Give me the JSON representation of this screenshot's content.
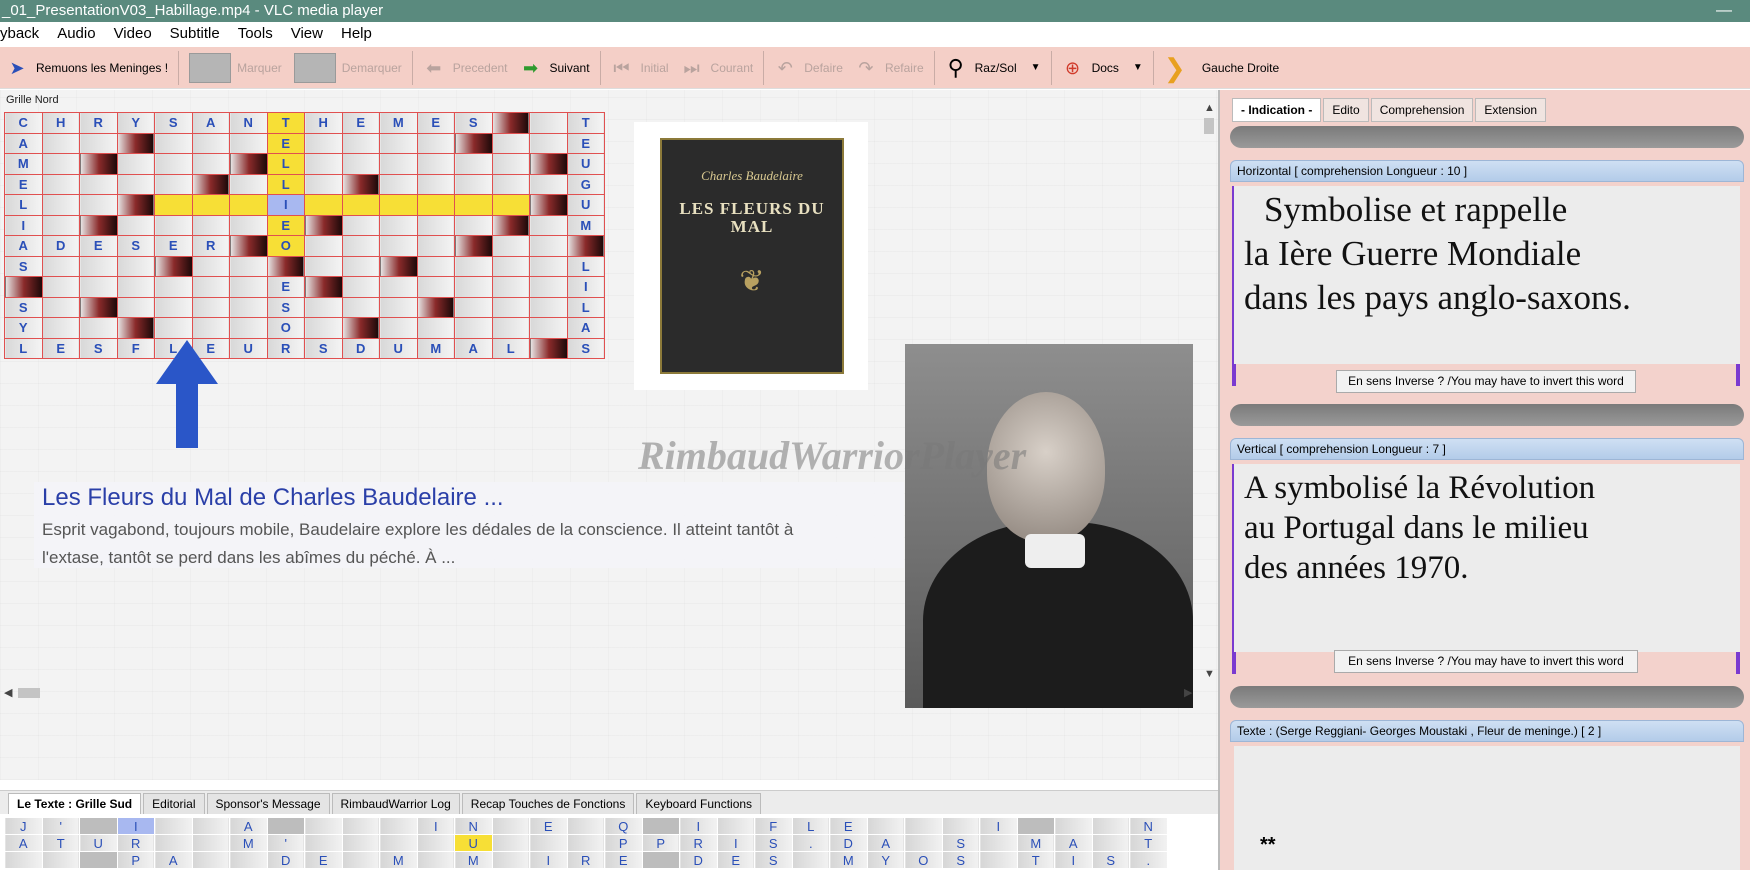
{
  "window": {
    "title": "_01_PresentationV03_Habillage.mp4 - VLC media player",
    "minimize": "—"
  },
  "menu": [
    "yback",
    "Audio",
    "Video",
    "Subtitle",
    "Tools",
    "View",
    "Help"
  ],
  "toolbar": {
    "remuons": "Remuons les Meninges !",
    "marquer": "Marquer",
    "demarquer": "Demarquer",
    "precedent": "Precedent",
    "suivant": "Suivant",
    "initial": "Initial",
    "courant": "Courant",
    "defaire": "Defaire",
    "refaire": "Refaire",
    "razsol": "Raz/Sol",
    "docs": "Docs",
    "gauche_droite": "Gauche Droite"
  },
  "left": {
    "grid_label": "Grille Nord",
    "watermark": "RimbaudWarriorPlayer",
    "snippet_title": "Les Fleurs du Mal de Charles Baudelaire ...",
    "snippet_line1": "Esprit vagabond, toujours mobile, Baudelaire explore les dédales de la conscience. Il atteint tantôt à",
    "snippet_line2": "l'extase, tantôt se perd dans les abîmes du péché. À ...",
    "book_author": "Charles Baudelaire",
    "book_title": "LES FLEURS DU MAL"
  },
  "bottom_tabs": [
    "Le Texte : Grille Sud",
    "Editorial",
    "Sponsor's Message",
    "RimbaudWarrior Log",
    "Recap Touches de Fonctions",
    "Keyboard Functions"
  ],
  "right": {
    "tabs": [
      "- Indication -",
      "Edito",
      "Comprehension",
      "Extension"
    ],
    "h_header": "Horizontal [ comprehension  Longueur : 10 ]",
    "h_line1": "Symbolise et rappelle",
    "h_line2": "la Ière Guerre Mondiale",
    "h_line3": "dans les pays anglo-saxons.",
    "invert": "En sens Inverse ? /You may have to invert this word",
    "v_header": "Vertical [ comprehension  Longueur : 7 ]",
    "v_line1": "A symbolisé la Révolution",
    "v_line2": "au Portugal dans le milieu",
    "v_line3": "des années 1970.",
    "texte_header": "Texte :  (Serge Reggiani- Georges Moustaki , Fleur de meninge.)  [ 2 ]",
    "stars": "**"
  },
  "grid_north": [
    [
      "C",
      "H",
      "R",
      "Y",
      "S",
      "A",
      "N",
      "T",
      "H",
      "E",
      "M",
      "E",
      "S",
      "#",
      "",
      "T"
    ],
    [
      "A",
      "",
      "",
      "#",
      "",
      "",
      "",
      "E",
      "",
      "",
      "",
      "",
      "#",
      "",
      "",
      "E"
    ],
    [
      "M",
      "",
      "#",
      "",
      "",
      "",
      "#",
      "L",
      "",
      "",
      "",
      "",
      "",
      "",
      "#",
      "U"
    ],
    [
      "E",
      "",
      "",
      "",
      "",
      "#",
      "",
      "L",
      "",
      "#",
      "",
      "",
      "",
      "",
      "",
      "G"
    ],
    [
      "L",
      "",
      "",
      "#",
      "",
      "",
      "",
      "I",
      "",
      "",
      "",
      "",
      "",
      "",
      "#",
      "U"
    ],
    [
      "I",
      "",
      "#",
      "",
      "",
      "",
      "",
      "E",
      "#",
      "",
      "",
      "",
      "",
      "#",
      "",
      "M"
    ],
    [
      "A",
      "D",
      "E",
      "S",
      "E",
      "R",
      "#",
      "O",
      "",
      "",
      "",
      "",
      "#",
      "",
      "",
      "#"
    ],
    [
      "S",
      "",
      "",
      "",
      "#",
      "",
      "",
      "#",
      "",
      "",
      "#",
      "",
      "",
      "",
      "",
      "L"
    ],
    [
      "#",
      "",
      "",
      "",
      "",
      "",
      "",
      "E",
      "#",
      "",
      "",
      "",
      "",
      "",
      "",
      "I"
    ],
    [
      "S",
      "",
      "#",
      "",
      "",
      "",
      "",
      "S",
      "",
      "",
      "",
      "#",
      "",
      "",
      "",
      "L"
    ],
    [
      "Y",
      "",
      "",
      "#",
      "",
      "",
      "",
      "O",
      "",
      "#",
      "",
      "",
      "",
      "",
      "",
      "A"
    ],
    [
      "L",
      "E",
      "S",
      "F",
      "L",
      "E",
      "U",
      "R",
      "S",
      "D",
      "U",
      "M",
      "A",
      "L",
      "#",
      "S"
    ]
  ],
  "grid_north_yellow": [
    4
  ],
  "grid_south": [
    [
      "J",
      "'",
      "",
      "I",
      "",
      "",
      "A",
      "",
      "",
      "",
      "",
      "I",
      "N",
      "",
      "E",
      "",
      "Q",
      "",
      "I",
      "",
      "F",
      "L",
      "E",
      "",
      "",
      "",
      "I",
      "",
      "",
      "",
      "N"
    ],
    [
      "A",
      "T",
      "U",
      "R",
      "",
      "",
      "M",
      "'",
      "",
      "",
      "",
      "",
      "U",
      "",
      "",
      "",
      "P",
      "P",
      "R",
      "I",
      "S",
      ".",
      "D",
      "A",
      "",
      "S",
      "",
      "M",
      "A",
      "",
      "T"
    ],
    [
      "",
      "",
      "",
      "P",
      "A",
      "",
      "",
      "D",
      "E",
      "",
      "M",
      "",
      "M",
      "",
      "I",
      "R",
      "E",
      "",
      "D",
      "E",
      "S",
      "",
      "M",
      "Y",
      "O",
      "S",
      "",
      "T",
      "I",
      "S",
      "."
    ]
  ]
}
